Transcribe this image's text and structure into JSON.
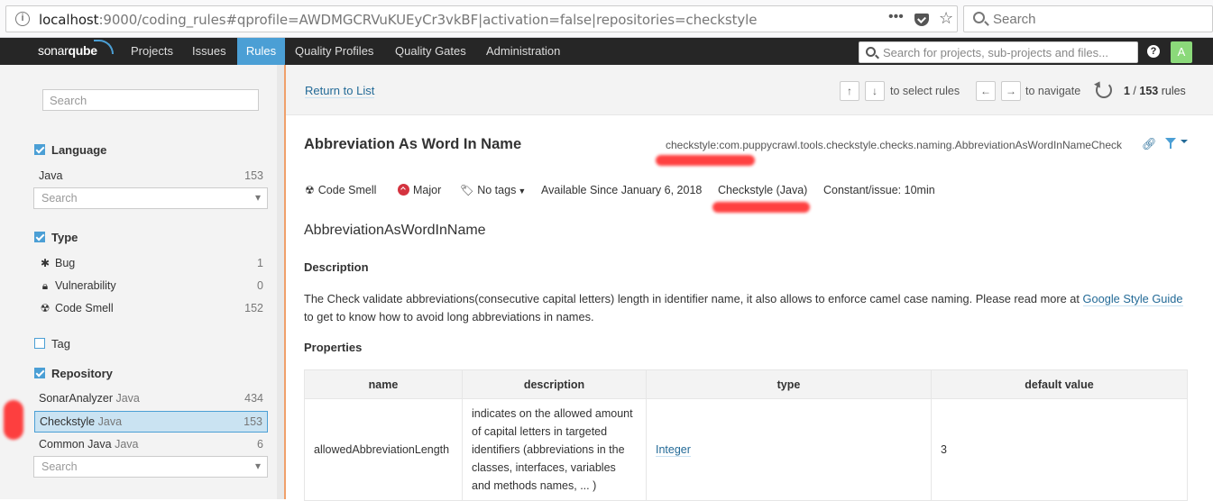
{
  "browser": {
    "url_host": "localhost",
    "url_rest": ":9000/coding_rules#qprofile=AWDMGCRVuKUEyCr3vkBF|activation=false|repositories=checkstyle",
    "search_placeholder": "Search",
    "more_label": "•••"
  },
  "nav": {
    "logo_main": "sonar",
    "logo_sub": "qube",
    "items": [
      "Projects",
      "Issues",
      "Rules",
      "Quality Profiles",
      "Quality Gates",
      "Administration"
    ],
    "active": "Rules",
    "search_placeholder": "Search for projects, sub-projects and files...",
    "help": "?",
    "avatar": "A"
  },
  "sidebar": {
    "search_placeholder": "Search",
    "language": {
      "title": "Language",
      "items": [
        {
          "label": "Java",
          "count": "153"
        }
      ],
      "select_placeholder": "Search"
    },
    "type": {
      "title": "Type",
      "items": [
        {
          "label": "Bug",
          "count": "1",
          "icon": "bug-icon"
        },
        {
          "label": "Vulnerability",
          "count": "0",
          "icon": "lock-icon"
        },
        {
          "label": "Code Smell",
          "count": "152",
          "icon": "code-smell-icon"
        }
      ]
    },
    "tag": {
      "title": "Tag"
    },
    "repository": {
      "title": "Repository",
      "items": [
        {
          "label": "SonarAnalyzer",
          "sub": "Java",
          "count": "434"
        },
        {
          "label": "Checkstyle",
          "sub": "Java",
          "count": "153"
        },
        {
          "label": "Common Java",
          "sub": "Java",
          "count": "6"
        }
      ],
      "select_placeholder": "Search"
    }
  },
  "topbar": {
    "return_label": "Return to List",
    "up": "↑",
    "down": "↓",
    "select_msg": "to select rules",
    "left": "←",
    "right": "→",
    "navigate_msg": "to navigate",
    "page_current": "1",
    "page_sep": " / ",
    "page_total": "153",
    "page_suffix": " rules"
  },
  "rule": {
    "title": "Abbreviation As Word In Name",
    "key": "checkstyle:com.puppycrawl.tools.checkstyle.checks.naming.AbbreviationAsWordInNameCheck",
    "type": "Code Smell",
    "severity": "Major",
    "tags": "No tags",
    "available_since": "Available Since January 6, 2018",
    "repository": "Checkstyle (Java)",
    "remediation": "Constant/issue: 10min",
    "name": "AbbreviationAsWordInName",
    "description_heading": "Description",
    "description_before": "The Check validate abbreviations(consecutive capital letters) length in identifier name, it also allows to enforce camel case naming. Please read more at ",
    "description_link": "Google Style Guide",
    "description_after": " to get to know how to avoid long abbreviations in names.",
    "properties_heading": "Properties",
    "properties_columns": [
      "name",
      "description",
      "type",
      "default value"
    ],
    "properties_rows": [
      {
        "name": "allowedAbbreviationLength",
        "description": "indicates on the allowed amount of capital letters in targeted identifiers (abbreviations in the classes, interfaces, variables and methods names, ... )",
        "type": "Integer",
        "default": "3"
      }
    ]
  },
  "colors": {
    "accent": "#4b9fd5",
    "nav_bg": "#262626",
    "link": "#236a97",
    "highlight": "#ff2020"
  }
}
